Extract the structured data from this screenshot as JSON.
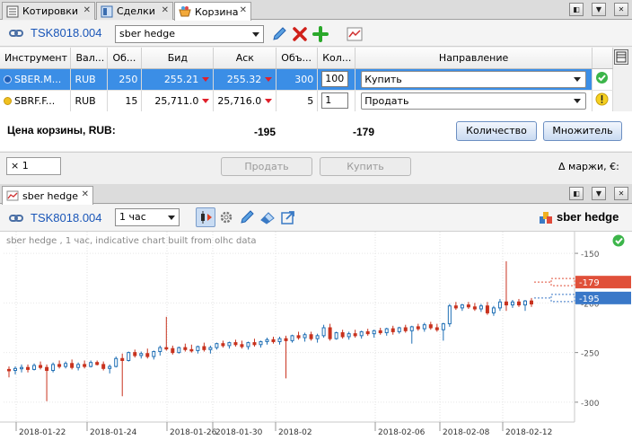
{
  "top_tabs": [
    {
      "label": "Котировки"
    },
    {
      "label": "Сделки"
    },
    {
      "label": "Корзина"
    }
  ],
  "basket": {
    "account": "TSK8018.004",
    "basket_name": "sber hedge",
    "columns": [
      "Инструмент",
      "Вал...",
      "Об...",
      "Бид",
      "Аск",
      "Объ...",
      "Кол...",
      "Направление"
    ],
    "rows": [
      {
        "instrument": "SBER.M...",
        "currency": "RUB",
        "vol_bid": "250",
        "bid": "255.21",
        "ask": "255.32",
        "vol_ask": "300",
        "qty": "100",
        "direction": "Купить",
        "dot_color": "#1f5fb8"
      },
      {
        "instrument": "SBRF.F...",
        "currency": "RUB",
        "vol_bid": "15",
        "bid": "25,711.0",
        "ask": "25,716.0",
        "vol_ask": "5",
        "qty": "1",
        "direction": "Продать",
        "dot_color": "#f0c020"
      }
    ],
    "price_label": "Цена корзины, RUB:",
    "price_bid": "-195",
    "price_ask": "-179",
    "quantity_button": "Количество",
    "multiplier_button": "Множитель",
    "multiplier_value": "× 1",
    "sell_button": "Продать",
    "buy_button": "Купить",
    "margin_label": "Δ маржи, €: "
  },
  "chart_tab": {
    "label": "sber hedge"
  },
  "chart_toolbar": {
    "account": "TSK8018.004",
    "interval": "1 час",
    "instrument_label": "sber hedge"
  },
  "chart_data": {
    "type": "candlestick",
    "subtitle": "sber hedge , 1 час, indicative chart built from olhc data",
    "x_ticks": [
      "2018-01-22",
      "2018-01-24",
      "2018-01-26",
      "2018-01-30",
      "2018-02",
      "2018-02-06",
      "2018-02-08",
      "2018-02-12"
    ],
    "y_ticks": [
      "-150",
      "-200",
      "-250",
      "-300"
    ],
    "ylim": [
      -320,
      -130
    ],
    "last_ask_label": "-179",
    "last_bid_label": "-195",
    "last_ask_color": "#e0503a",
    "last_bid_color": "#3a78c8",
    "up_color": "#1f6fb5",
    "down_color": "#c8321e",
    "candles": [
      {
        "o": -267,
        "h": -264,
        "l": -275,
        "c": -268
      },
      {
        "o": -268,
        "h": -264,
        "l": -272,
        "c": -266
      },
      {
        "o": -266,
        "h": -262,
        "l": -270,
        "c": -265
      },
      {
        "o": -265,
        "h": -262,
        "l": -270,
        "c": -267
      },
      {
        "o": -267,
        "h": -261,
        "l": -268,
        "c": -263
      },
      {
        "o": -263,
        "h": -259,
        "l": -267,
        "c": -265
      },
      {
        "o": -265,
        "h": -262,
        "l": -299,
        "c": -268
      },
      {
        "o": -268,
        "h": -260,
        "l": -270,
        "c": -262
      },
      {
        "o": -262,
        "h": -258,
        "l": -266,
        "c": -264
      },
      {
        "o": -264,
        "h": -259,
        "l": -266,
        "c": -261
      },
      {
        "o": -261,
        "h": -257,
        "l": -267,
        "c": -265
      },
      {
        "o": -265,
        "h": -260,
        "l": -268,
        "c": -262
      },
      {
        "o": -262,
        "h": -258,
        "l": -266,
        "c": -264
      },
      {
        "o": -264,
        "h": -258,
        "l": -265,
        "c": -260
      },
      {
        "o": -260,
        "h": -258,
        "l": -263,
        "c": -262
      },
      {
        "o": -262,
        "h": -259,
        "l": -268,
        "c": -266
      },
      {
        "o": -266,
        "h": -262,
        "l": -271,
        "c": -264
      },
      {
        "o": -264,
        "h": -254,
        "l": -265,
        "c": -256
      },
      {
        "o": -256,
        "h": -251,
        "l": -294,
        "c": -258
      },
      {
        "o": -258,
        "h": -249,
        "l": -259,
        "c": -250
      },
      {
        "o": -250,
        "h": -247,
        "l": -255,
        "c": -253
      },
      {
        "o": -253,
        "h": -249,
        "l": -256,
        "c": -251
      },
      {
        "o": -251,
        "h": -246,
        "l": -256,
        "c": -254
      },
      {
        "o": -254,
        "h": -248,
        "l": -257,
        "c": -249
      },
      {
        "o": -249,
        "h": -243,
        "l": -253,
        "c": -245
      },
      {
        "o": -245,
        "h": -214,
        "l": -248,
        "c": -246
      },
      {
        "o": -246,
        "h": -243,
        "l": -252,
        "c": -250
      },
      {
        "o": -250,
        "h": -244,
        "l": -251,
        "c": -245
      },
      {
        "o": -245,
        "h": -241,
        "l": -249,
        "c": -247
      },
      {
        "o": -247,
        "h": -242,
        "l": -250,
        "c": -248
      },
      {
        "o": -248,
        "h": -243,
        "l": -251,
        "c": -244
      },
      {
        "o": -244,
        "h": -240,
        "l": -249,
        "c": -247
      },
      {
        "o": -247,
        "h": -243,
        "l": -251,
        "c": -245
      },
      {
        "o": -245,
        "h": -240,
        "l": -247,
        "c": -241
      },
      {
        "o": -241,
        "h": -238,
        "l": -245,
        "c": -243
      },
      {
        "o": -243,
        "h": -239,
        "l": -246,
        "c": -240
      },
      {
        "o": -240,
        "h": -237,
        "l": -244,
        "c": -242
      },
      {
        "o": -242,
        "h": -238,
        "l": -246,
        "c": -244
      },
      {
        "o": -244,
        "h": -239,
        "l": -247,
        "c": -240
      },
      {
        "o": -240,
        "h": -236,
        "l": -244,
        "c": -242
      },
      {
        "o": -242,
        "h": -238,
        "l": -245,
        "c": -239
      },
      {
        "o": -239,
        "h": -235,
        "l": -242,
        "c": -237
      },
      {
        "o": -237,
        "h": -234,
        "l": -241,
        "c": -239
      },
      {
        "o": -239,
        "h": -234,
        "l": -242,
        "c": -236
      },
      {
        "o": -236,
        "h": -233,
        "l": -276,
        "c": -238
      },
      {
        "o": -238,
        "h": -232,
        "l": -240,
        "c": -233
      },
      {
        "o": -233,
        "h": -229,
        "l": -237,
        "c": -235
      },
      {
        "o": -235,
        "h": -230,
        "l": -239,
        "c": -232
      },
      {
        "o": -232,
        "h": -229,
        "l": -238,
        "c": -236
      },
      {
        "o": -236,
        "h": -231,
        "l": -240,
        "c": -233
      },
      {
        "o": -233,
        "h": -222,
        "l": -235,
        "c": -225
      },
      {
        "o": -225,
        "h": -221,
        "l": -238,
        "c": -236
      },
      {
        "o": -236,
        "h": -229,
        "l": -237,
        "c": -230
      },
      {
        "o": -230,
        "h": -227,
        "l": -236,
        "c": -234
      },
      {
        "o": -234,
        "h": -229,
        "l": -237,
        "c": -231
      },
      {
        "o": -231,
        "h": -227,
        "l": -235,
        "c": -233
      },
      {
        "o": -233,
        "h": -228,
        "l": -236,
        "c": -229
      },
      {
        "o": -229,
        "h": -226,
        "l": -233,
        "c": -231
      },
      {
        "o": -231,
        "h": -227,
        "l": -235,
        "c": -228
      },
      {
        "o": -228,
        "h": -225,
        "l": -232,
        "c": -230
      },
      {
        "o": -230,
        "h": -225,
        "l": -233,
        "c": -226
      },
      {
        "o": -226,
        "h": -223,
        "l": -232,
        "c": -229
      },
      {
        "o": -229,
        "h": -224,
        "l": -231,
        "c": -225
      },
      {
        "o": -225,
        "h": -222,
        "l": -230,
        "c": -228
      },
      {
        "o": -228,
        "h": -223,
        "l": -241,
        "c": -224
      },
      {
        "o": -224,
        "h": -221,
        "l": -228,
        "c": -226
      },
      {
        "o": -226,
        "h": -220,
        "l": -229,
        "c": -222
      },
      {
        "o": -222,
        "h": -219,
        "l": -227,
        "c": -225
      },
      {
        "o": -225,
        "h": -221,
        "l": -229,
        "c": -227
      },
      {
        "o": -227,
        "h": -220,
        "l": -238,
        "c": -221
      },
      {
        "o": -221,
        "h": -201,
        "l": -224,
        "c": -203
      },
      {
        "o": -203,
        "h": -199,
        "l": -207,
        "c": -205
      },
      {
        "o": -205,
        "h": -201,
        "l": -208,
        "c": -202
      },
      {
        "o": -202,
        "h": -199,
        "l": -206,
        "c": -204
      },
      {
        "o": -204,
        "h": -200,
        "l": -208,
        "c": -206
      },
      {
        "o": -206,
        "h": -201,
        "l": -209,
        "c": -203
      },
      {
        "o": -203,
        "h": -199,
        "l": -212,
        "c": -210
      },
      {
        "o": -210,
        "h": -203,
        "l": -213,
        "c": -205
      },
      {
        "o": -205,
        "h": -196,
        "l": -208,
        "c": -199
      },
      {
        "o": -199,
        "h": -158,
        "l": -208,
        "c": -202
      },
      {
        "o": -202,
        "h": -197,
        "l": -205,
        "c": -199
      },
      {
        "o": -199,
        "h": -196,
        "l": -204,
        "c": -202
      },
      {
        "o": -202,
        "h": -197,
        "l": -208,
        "c": -198
      },
      {
        "o": -198,
        "h": -195,
        "l": -204,
        "c": -201
      }
    ]
  }
}
